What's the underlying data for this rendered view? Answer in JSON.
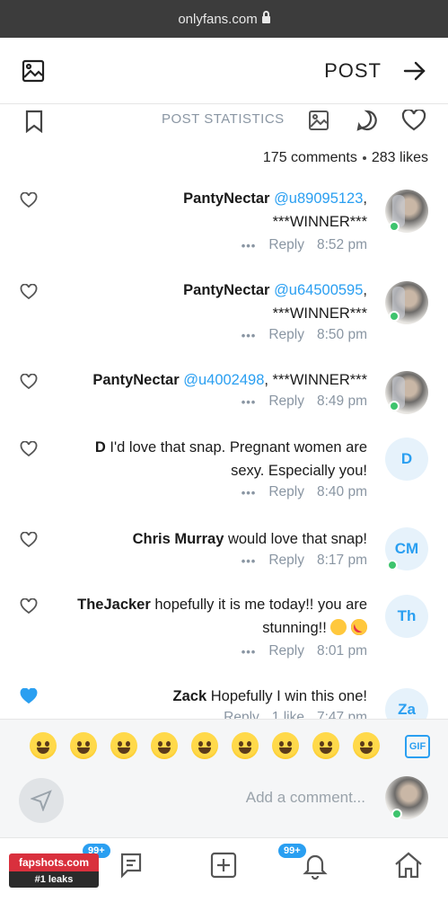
{
  "browser": {
    "url": "onlyfans.com"
  },
  "header": {
    "title": "POST"
  },
  "actions": {
    "stats_label": "POST STATISTICS"
  },
  "post": {
    "likes": "283 likes",
    "comments": "175 comments"
  },
  "comments": [
    {
      "user": "PantyNectar",
      "mention": "@u89095123",
      "body_after": ",",
      "line2": "***WINNER***",
      "time": "8:52 pm",
      "reply": "Reply",
      "avatar": "photo",
      "online": true,
      "liked": false
    },
    {
      "user": "PantyNectar",
      "mention": "@u64500595",
      "body_after": ",",
      "line2": "***WINNER***",
      "time": "8:50 pm",
      "reply": "Reply",
      "avatar": "photo",
      "online": true,
      "liked": false
    },
    {
      "user": "PantyNectar",
      "mention": "@u4002498",
      "body_after": ", ***WINNER***",
      "line2": "",
      "time": "8:49 pm",
      "reply": "Reply",
      "avatar": "photo",
      "online": true,
      "liked": false
    },
    {
      "user": "D",
      "body": "I'd love that snap. Pregnant women are sexy. Especially you!",
      "time": "8:40 pm",
      "reply": "Reply",
      "avatar": "D",
      "online": false,
      "liked": false
    },
    {
      "user": "Chris Murray",
      "body": "would love that snap!",
      "time": "8:17 pm",
      "reply": "Reply",
      "avatar": "CM",
      "online": true,
      "liked": false
    },
    {
      "user": "TheJacker",
      "body": "hopefully it is me today!! you are stunning!!",
      "time": "8:01 pm",
      "reply": "Reply",
      "avatar": "Th",
      "online": false,
      "liked": false
    },
    {
      "user": "Zack",
      "body": "Hopefully I win this one!",
      "time": "7:47 pm",
      "likes": "1 like",
      "reply": "Reply",
      "avatar": "Za",
      "online": false,
      "liked": true
    }
  ],
  "composer": {
    "placeholder": "Add a comment..."
  },
  "emoji_bar": {
    "gif_label": "GIF"
  },
  "nav": {
    "messages_badge": "99+",
    "notifications_badge": "99+"
  },
  "watermark": {
    "line1": "fapshots.com",
    "line2": "#1 leaks"
  },
  "colors": {
    "accent": "#2a9ff1",
    "online": "#3ec46d",
    "muted": "#8a96a3"
  }
}
